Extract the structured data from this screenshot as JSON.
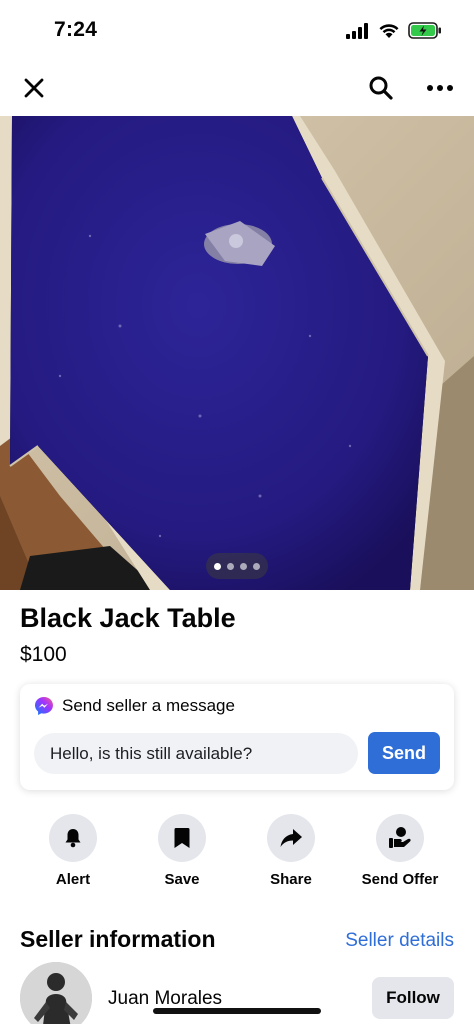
{
  "status_bar": {
    "time": "7:24"
  },
  "icons": {
    "close": "close-icon",
    "search": "search-icon",
    "more": "more-icon",
    "messenger": "messenger-icon",
    "alert": "bell-icon",
    "save": "bookmark-icon",
    "share": "share-icon",
    "offer": "offer-icon"
  },
  "listing": {
    "title": "Black Jack Table",
    "price": "$100",
    "photo_count": 4,
    "current_photo": 1
  },
  "message": {
    "heading": "Send seller a message",
    "input_value": "Hello, is this still available?",
    "send_label": "Send"
  },
  "actions": [
    {
      "label": "Alert"
    },
    {
      "label": "Save"
    },
    {
      "label": "Share"
    },
    {
      "label": "Send Offer"
    }
  ],
  "seller": {
    "section_title": "Seller information",
    "details_link": "Seller details",
    "name": "Juan Morales",
    "follow_label": "Follow"
  },
  "colors": {
    "accent": "#2f6ed7",
    "button_gray": "#e4e6eb",
    "felt": "#2a1e86"
  }
}
